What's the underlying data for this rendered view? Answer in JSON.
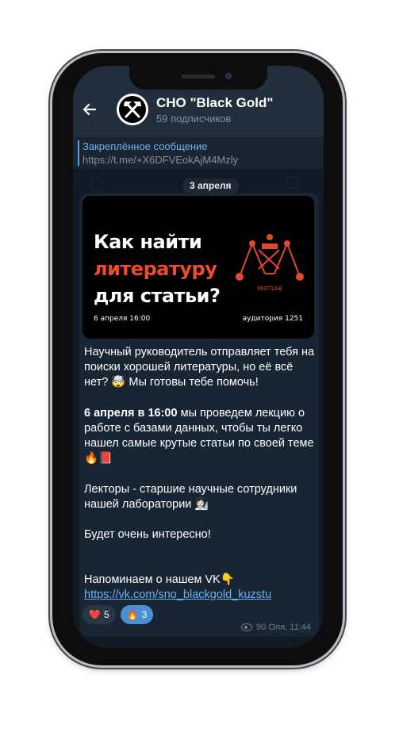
{
  "header": {
    "title": "СНО \"Black Gold\"",
    "subtitle": "59 подписчиков",
    "back_icon": "arrow-left-icon"
  },
  "pinned": {
    "title": "Закреплённое сообщение",
    "text": "https://t.me/+X6DFVEokAjM4Mzly"
  },
  "date_separator": "3 апреля",
  "banner": {
    "line1": "Как найти",
    "line2": "литературу",
    "line3": "для статьи?",
    "date": "6 апреля 16:00",
    "room": "аудитория 1251",
    "logo_text": "MIOTLAB"
  },
  "message": {
    "p1": "Научный руководитель отправляет тебя на поиски хорошей литературы, но её всё нет? 🤯 Мы готовы тебе помочь!",
    "p2_bold": "6 апреля в 16:00",
    "p2_rest": " мы проведем лекцию о работе с базами данных, чтобы ты легко нашел самые крутые статьи по своей теме 🔥📕",
    "p3": "Лекторы - старшие научные сотрудники нашей лаборатории 👩🏻‍🔬",
    "p4": "Будет очень интересно!",
    "p5": "Напоминаем о нашем VK👇",
    "link": "https://vk.com/sno_blackgold_kuzstu"
  },
  "reactions": [
    {
      "emoji": "❤️",
      "count": "5",
      "icon": "heart-icon"
    },
    {
      "emoji": "🔥",
      "count": "3",
      "icon": "fire-icon"
    }
  ],
  "meta": {
    "views": "90",
    "author_time": "Оля, 11:44"
  },
  "colors": {
    "header_bg": "#232e3c",
    "bubble_bg": "#182533",
    "accent": "#6ab2f2",
    "banner_red": "#f04a2f"
  }
}
